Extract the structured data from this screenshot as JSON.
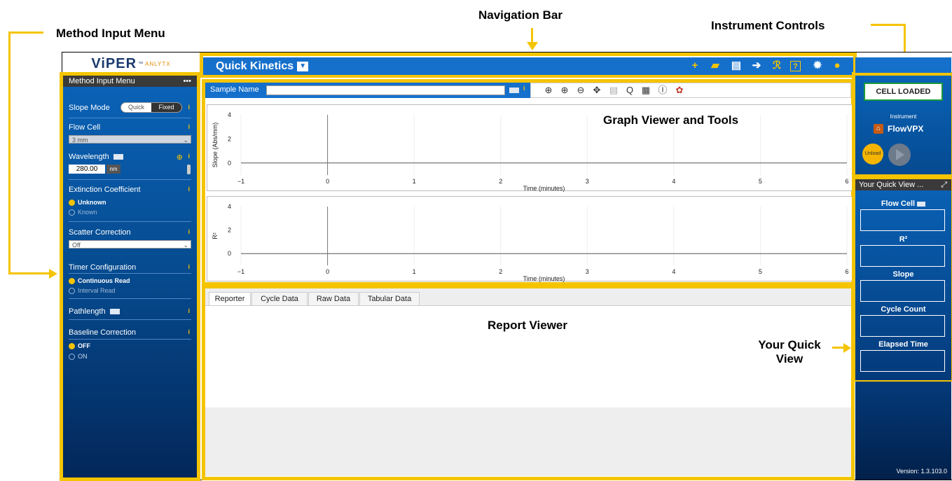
{
  "callouts": {
    "method_input_menu": "Method Input Menu",
    "navigation_bar": "Navigation Bar",
    "instrument_controls": "Instrument Controls",
    "graph_viewer": "Graph Viewer and Tools",
    "report_viewer": "Report Viewer",
    "your_quick_view_line1": "Your Quick",
    "your_quick_view_line2": "View"
  },
  "logo": {
    "main": "ViPER",
    "tm": "™",
    "sub": "ANLYTX"
  },
  "nav": {
    "title": "Quick Kinetics",
    "icons": [
      "plus-icon",
      "folder-open-icon",
      "save-icon",
      "export-icon",
      "rc-icon",
      "help-icon",
      "gear-icon",
      "user-icon"
    ],
    "icon_glyphs": [
      "+",
      "▰",
      "▤",
      "➔",
      "ℛ",
      "?",
      "✹",
      "●"
    ]
  },
  "method_menu": {
    "header": "Method Input Menu",
    "more": "•••",
    "slope_mode_label": "Slope Mode",
    "slope_mode_options": [
      "Quick",
      "Fixed"
    ],
    "slope_mode_selected": "Fixed",
    "flow_cell_label": "Flow Cell",
    "flow_cell_value": "3 mm",
    "wavelength_label": "Wavelength",
    "wavelength_value": "280.00",
    "wavelength_unit": "nm",
    "extinction_label": "Extinction Coefficient",
    "extinction_options": [
      "Unknown",
      "Known"
    ],
    "extinction_selected": "Unknown",
    "scatter_label": "Scatter Correction",
    "scatter_value": "Off",
    "timer_label": "Timer Configuration",
    "timer_options": [
      "Continuous Read",
      "Interval Read"
    ],
    "timer_selected": "Continuous Read",
    "pathlength_label": "Pathlength",
    "baseline_label": "Baseline Correction",
    "baseline_options": [
      "OFF",
      "ON"
    ],
    "baseline_selected": "OFF",
    "info": "i"
  },
  "sample": {
    "label": "Sample Name",
    "value": ""
  },
  "tools": [
    "zoom-fit-icon",
    "zoom-in-icon",
    "zoom-out-icon",
    "pan-icon",
    "grid-icon",
    "zoom-search-icon",
    "calculator-icon",
    "io-icon",
    "settings-icon"
  ],
  "tool_glyphs": [
    "⊕",
    "⊕",
    "⊖",
    "✥",
    "▤",
    "Q",
    "▦",
    "Ⓘ",
    "✿"
  ],
  "chart_data": [
    {
      "type": "line",
      "ylabel": "Slope (Abs/mm)",
      "xlabel": "Time (minutes)",
      "xticks": [
        -1,
        0,
        1,
        2,
        3,
        4,
        5,
        6
      ],
      "yticks": [
        0,
        2,
        4
      ],
      "xlim": [
        -1,
        6
      ],
      "ylim": [
        -1,
        4
      ],
      "series": []
    },
    {
      "type": "line",
      "ylabel": "R²",
      "xlabel": "Time (minutes)",
      "xticks": [
        -1,
        0,
        1,
        2,
        3,
        4,
        5,
        6
      ],
      "yticks": [
        0,
        2,
        4
      ],
      "xlim": [
        -1,
        6
      ],
      "ylim": [
        -1,
        4
      ],
      "series": []
    }
  ],
  "report": {
    "tabs": [
      "Reporter",
      "Cycle Data",
      "Raw Data",
      "Tabular Data"
    ],
    "active": "Reporter"
  },
  "instrument": {
    "status": "CELL LOADED",
    "label": "Instrument",
    "name": "FlowVPX",
    "unload": "Unload"
  },
  "quick_view": {
    "header": "Your Quick View ...",
    "fields": [
      "Flow Cell",
      "R²",
      "Slope",
      "Cycle Count",
      "Elapsed Time"
    ]
  },
  "version": "Version: 1.3.103.0",
  "colors": {
    "accent": "#f5c400",
    "nav_blue": "#1570cc",
    "panel_dark": "#03275a",
    "status_green": "#1a9a3a"
  }
}
